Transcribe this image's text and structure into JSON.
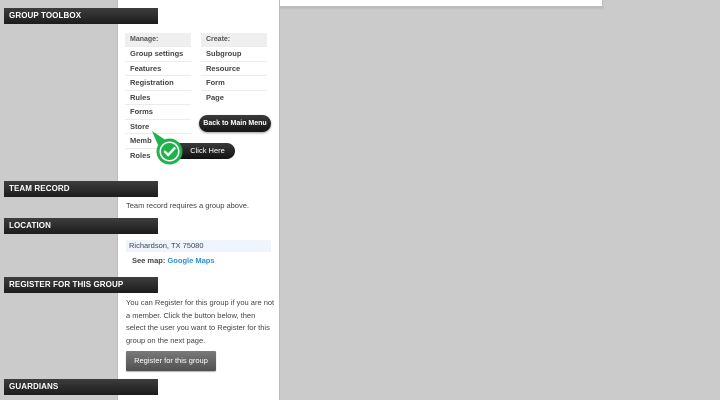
{
  "toolbox": {
    "title": "GROUP TOOLBOX",
    "manage": {
      "heading": "Manage:",
      "items": [
        "Group settings",
        "Features",
        "Registration",
        "Rules",
        "Forms",
        "Store",
        "Memb",
        "Roles"
      ]
    },
    "create": {
      "heading": "Create:",
      "items": [
        "Subgroup",
        "Resource",
        "Form",
        "Page"
      ]
    },
    "back_button": "Back to Main Menu",
    "click_here": "Click Here"
  },
  "team_record": {
    "title": "TEAM RECORD",
    "text": "Team record requires a group above."
  },
  "location": {
    "title": "LOCATION",
    "value": "Richardson, TX 75080",
    "see_map_label": "See map:",
    "map_link": "Google Maps"
  },
  "register": {
    "title": "REGISTER FOR THIS GROUP",
    "text": "You can Register for this group if you are not a member. Click the button below, then select the user you want to Register for this group on the next page.",
    "button": "Register for this group"
  },
  "guardians": {
    "title": "GUARDIANS"
  },
  "colors": {
    "background": "#cbcbcb",
    "header": "#1c1c1c",
    "link": "#2a8fd4",
    "check_green": "#1fb24a"
  }
}
